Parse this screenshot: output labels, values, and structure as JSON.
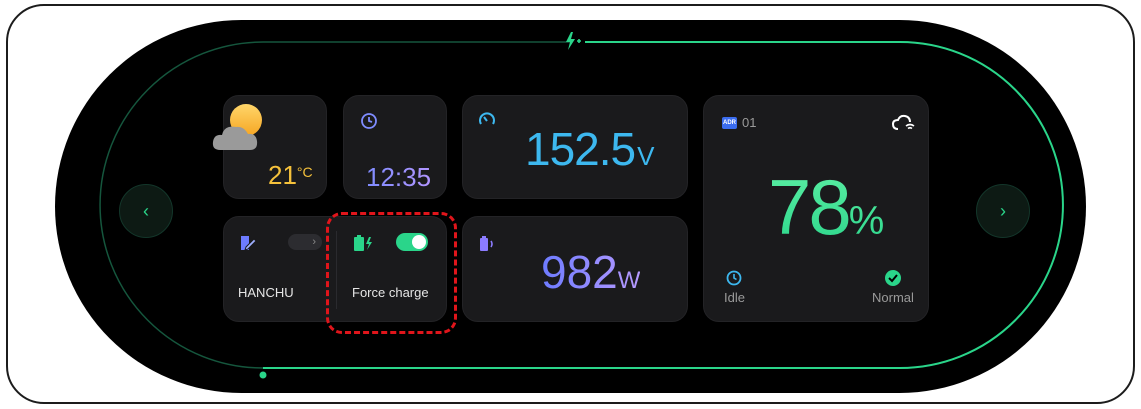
{
  "weather": {
    "temperature": "21",
    "unit": "°C",
    "icon": "partly-cloudy-icon"
  },
  "clock": {
    "time": "12:35",
    "icon": "clock-icon"
  },
  "voltage": {
    "value": "152.5",
    "unit": "V",
    "icon": "gauge-icon"
  },
  "power": {
    "value": "982",
    "unit": "W",
    "icon": "battery-signal-icon"
  },
  "device": {
    "name": "HANCHU",
    "icon": "device-edit-icon"
  },
  "force_charge": {
    "label": "Force charge",
    "enabled": true,
    "icon": "battery-charging-icon"
  },
  "battery": {
    "adr_badge": "ADR",
    "id": "01",
    "soc": "78",
    "soc_unit": "%",
    "mode": "Idle",
    "health": "Normal"
  },
  "colors": {
    "accent": "#2ad58a",
    "voltage": "#3db8ef",
    "temperature": "#f5c13b",
    "highlight": "#e0151b"
  }
}
